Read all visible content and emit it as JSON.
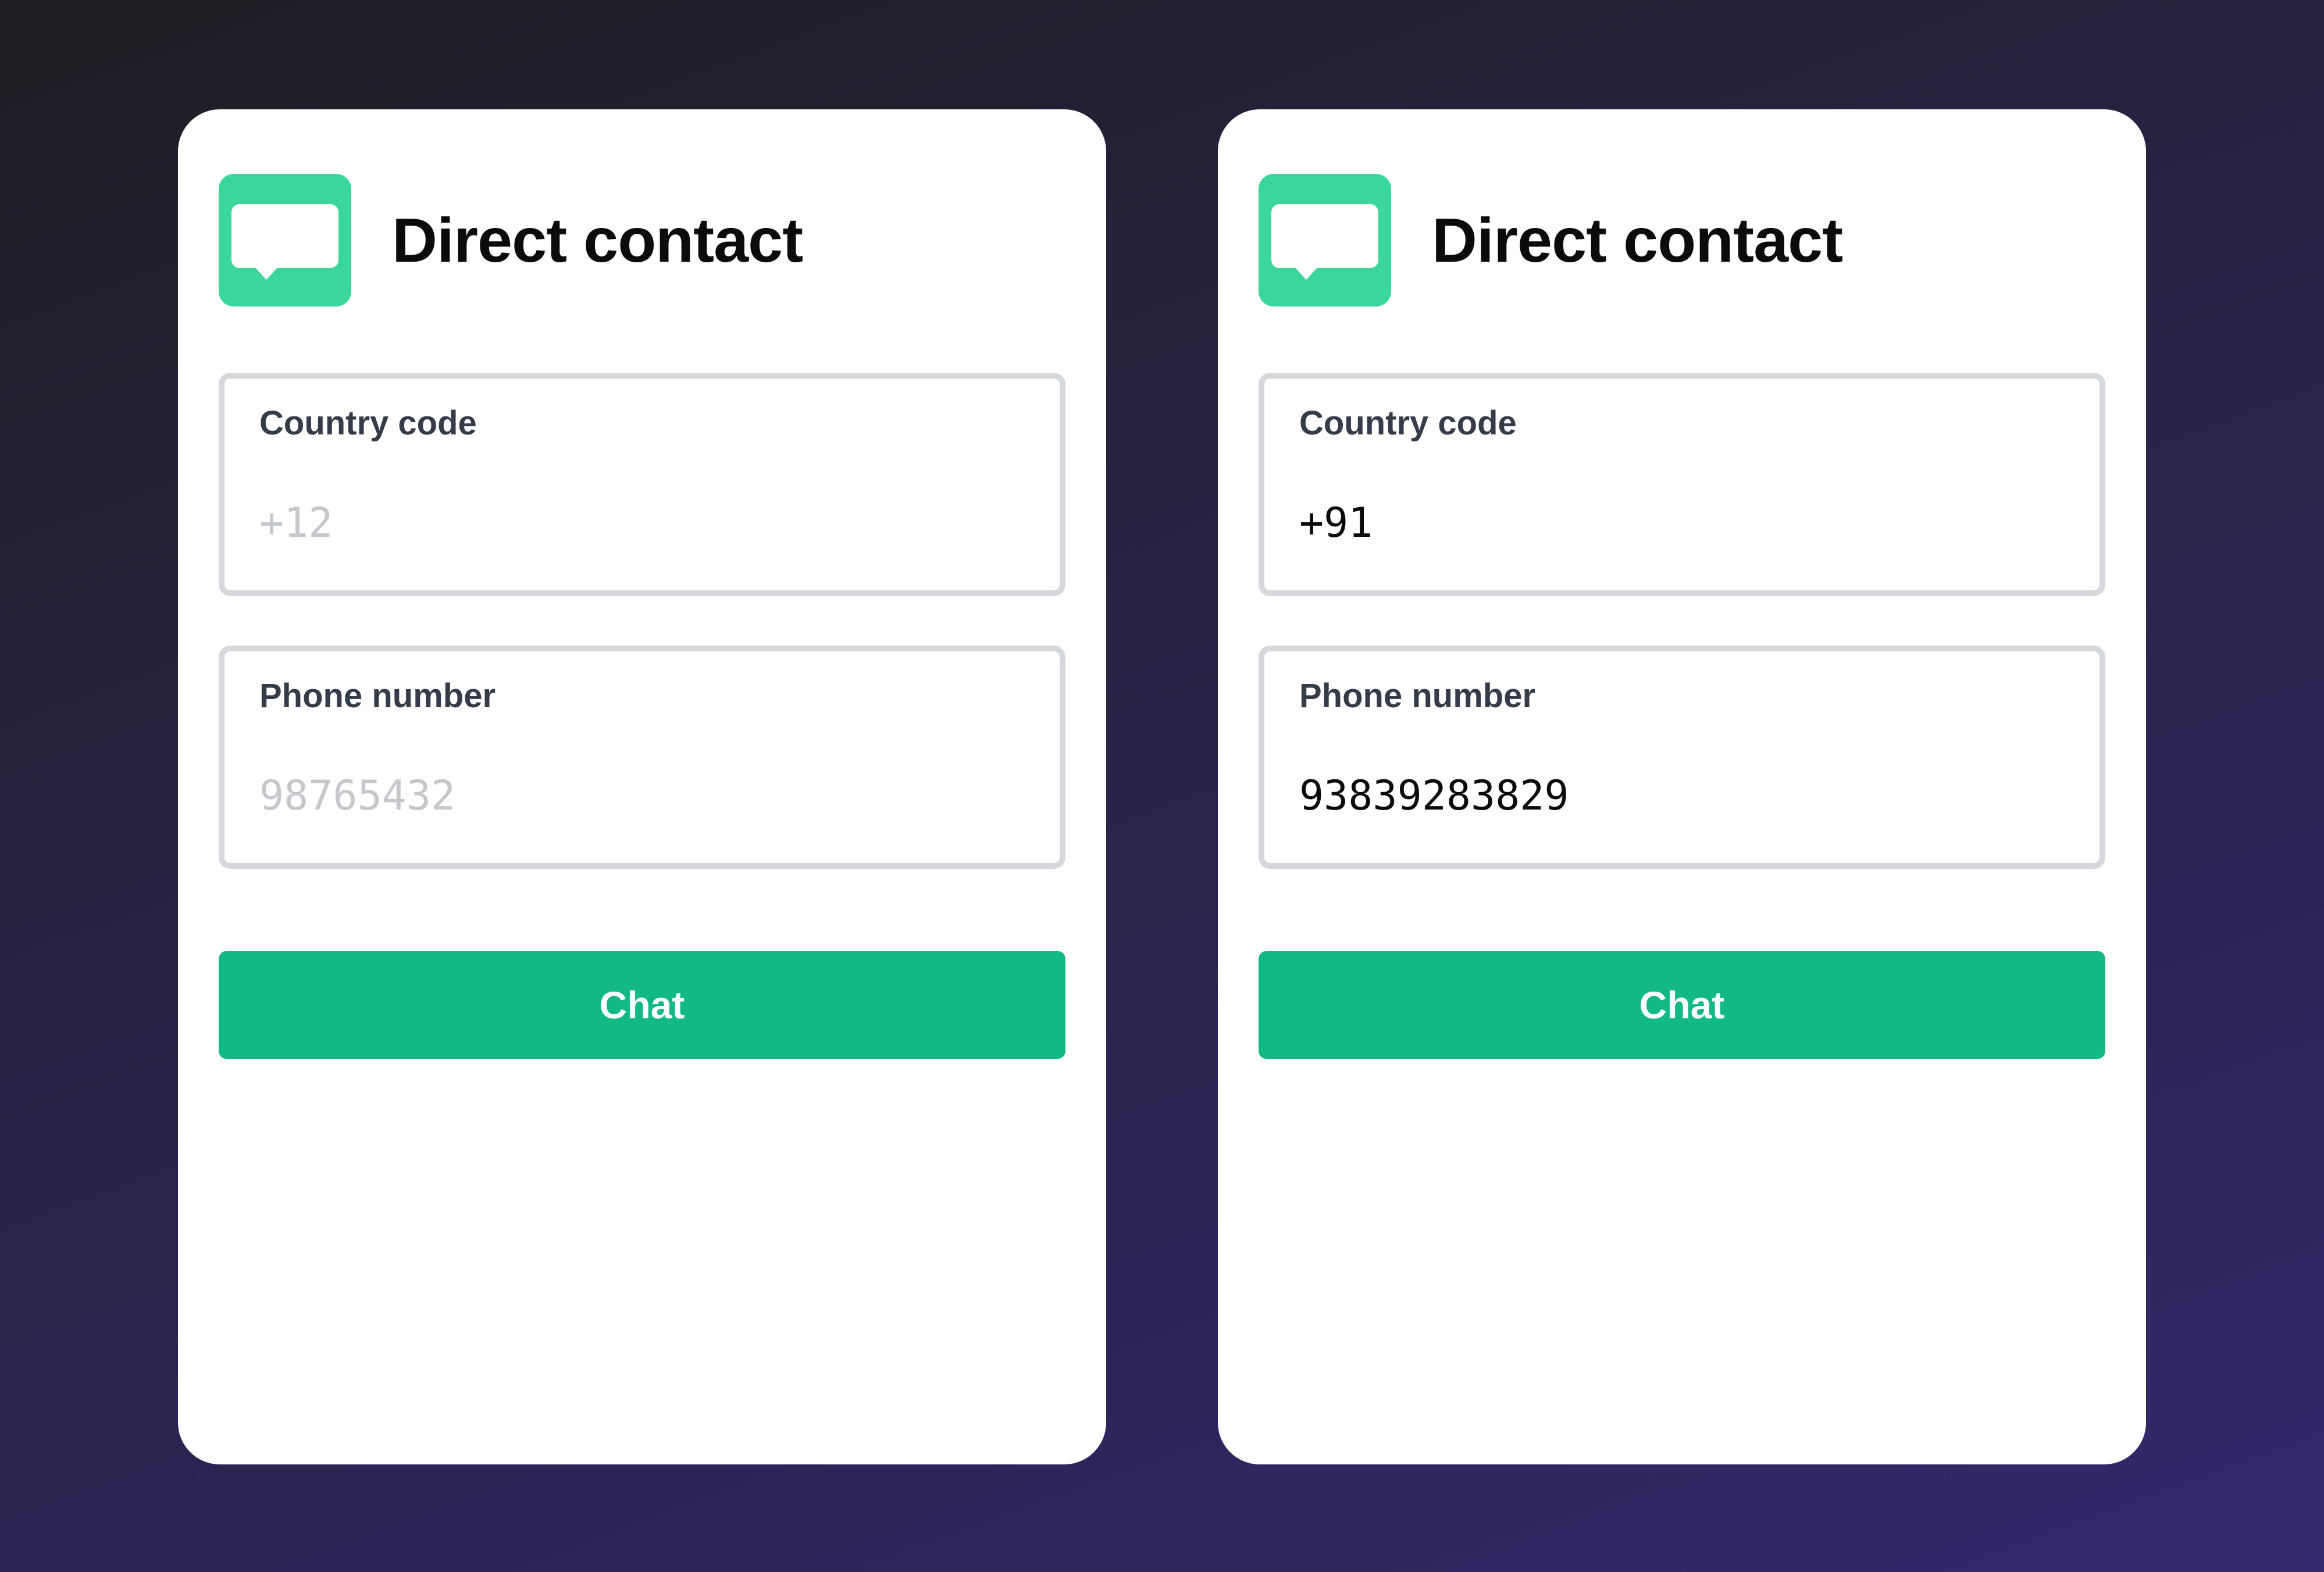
{
  "colors": {
    "accent": "#13b985",
    "icon_background": "#3bd69b",
    "field_border": "#d5d8dd",
    "label_text": "#343c4a",
    "placeholder_text": "#c4c7cc"
  },
  "cards": [
    {
      "icon": "chat-bubble-icon",
      "title": "Direct contact",
      "country_code": {
        "label": "Country code",
        "value": "",
        "placeholder": "+12"
      },
      "phone_number": {
        "label": "Phone number",
        "value": "",
        "placeholder": "98765432"
      },
      "chat_button_label": "Chat"
    },
    {
      "icon": "chat-bubble-icon",
      "title": "Direct contact",
      "country_code": {
        "label": "Country code",
        "value": "+91",
        "placeholder": ""
      },
      "phone_number": {
        "label": "Phone number",
        "value": "93839283829",
        "placeholder": ""
      },
      "chat_button_label": "Chat"
    }
  ]
}
